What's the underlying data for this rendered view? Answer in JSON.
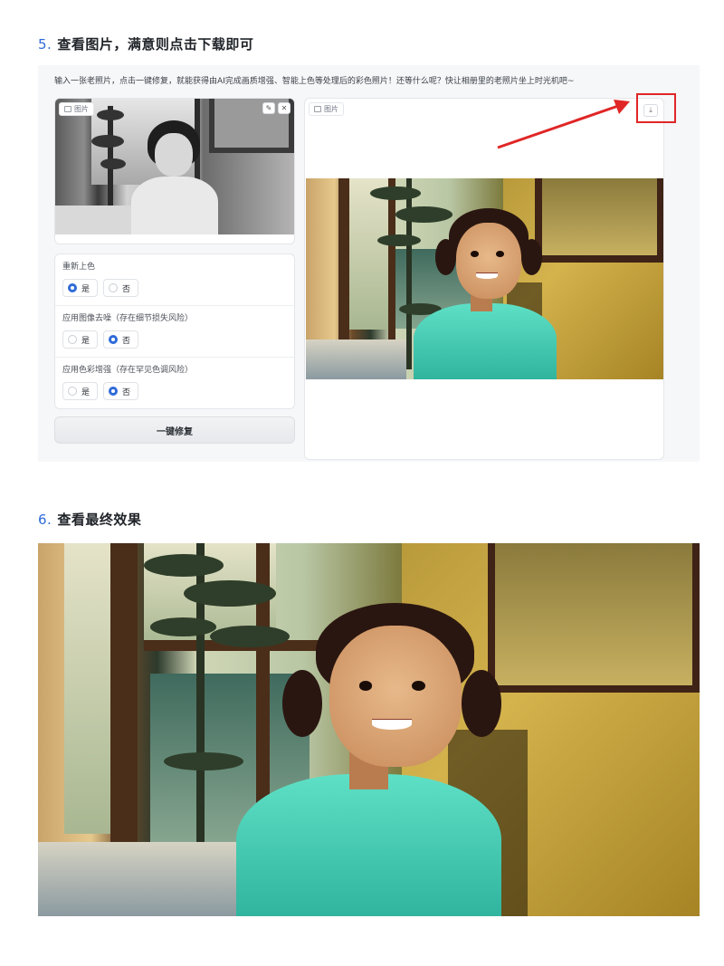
{
  "step5": {
    "number": "5.",
    "title": "查看图片，满意则点击下载即可"
  },
  "step6": {
    "number": "6.",
    "title": "查看最终效果"
  },
  "panel": {
    "intro": "输入一张老照片，点击一键修复，就能获得由AI完成画质增强、智能上色等处理后的彩色照片！还等什么呢？快让相册里的老照片坐上时光机吧~",
    "input_image": {
      "tag": "图片",
      "icon": "image-icon",
      "tools": [
        "edit-icon",
        "close-icon"
      ],
      "tool_glyphs": [
        "✎",
        "✕"
      ]
    },
    "options": [
      {
        "label": "重新上色",
        "choices": [
          "是",
          "否"
        ],
        "selected": "是"
      },
      {
        "label": "应用图像去噪（存在细节损失风险）",
        "choices": [
          "是",
          "否"
        ],
        "selected": "否"
      },
      {
        "label": "应用色彩增强（存在罕见色调风险）",
        "choices": [
          "是",
          "否"
        ],
        "selected": "否"
      }
    ],
    "fix_button": "一键修复",
    "output_image": {
      "tag": "图片",
      "icon": "image-icon",
      "download_icon": "download-icon",
      "download_glyph": "⤓"
    }
  },
  "colors": {
    "accent": "#2f6bd8",
    "highlight": "#e02626"
  }
}
